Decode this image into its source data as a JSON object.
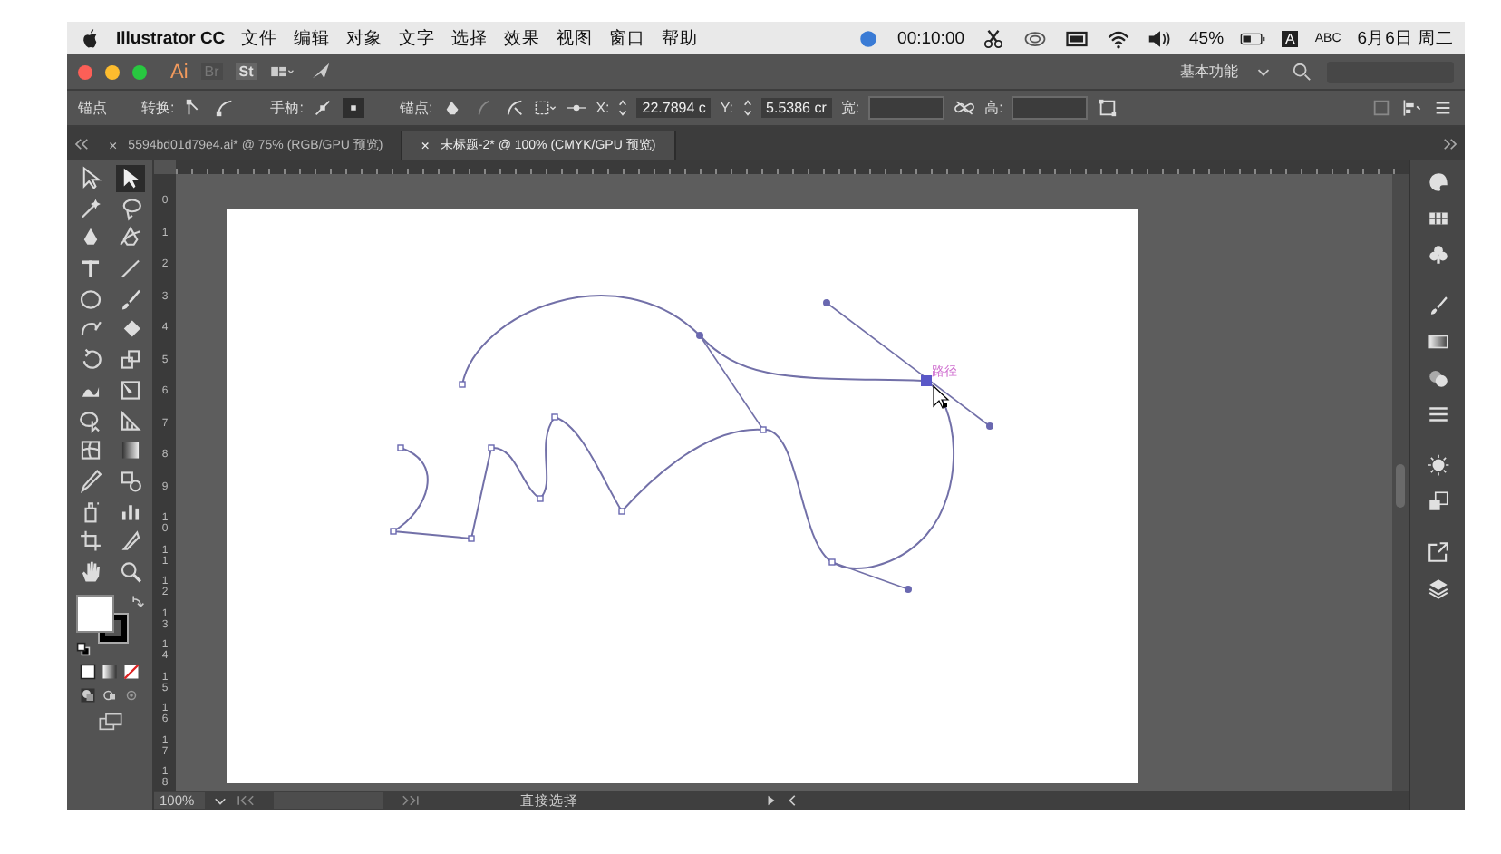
{
  "menu_bar": {
    "app": "Illustrator CC",
    "menus": [
      "文件",
      "编辑",
      "对象",
      "文字",
      "选择",
      "效果",
      "视图",
      "窗口",
      "帮助"
    ],
    "timer": "00:10:00",
    "battery": "45%",
    "input_badge": "A",
    "input_source": "ABC",
    "datetime": "6月6日 周二"
  },
  "app_bar": {
    "logo": "Ai",
    "bridge": "Br",
    "stock": "St",
    "workspace": "基本功能"
  },
  "control_bar": {
    "selection_label": "锚点",
    "convert_label": "转换:",
    "handles_label": "手柄:",
    "anchors_label": "锚点:",
    "x_label": "X:",
    "x_value": "22.7894 c",
    "y_label": "Y:",
    "y_value": "5.5386 cr",
    "width_label": "宽:",
    "height_label": "高:"
  },
  "tabs": [
    {
      "close": "×",
      "label": "5594bd01d79e4.ai* @ 75% (RGB/GPU 预览)",
      "selected": false
    },
    {
      "close": "×",
      "label": "未标题-2* @ 100% (CMYK/GPU 预览)",
      "selected": true
    }
  ],
  "tools": [
    {
      "kind": "selection",
      "selected": false
    },
    {
      "kind": "direct-selection",
      "selected": true
    },
    {
      "kind": "magic-wand",
      "selected": false
    },
    {
      "kind": "lasso",
      "selected": false
    },
    {
      "kind": "pen",
      "selected": false
    },
    {
      "kind": "curvature",
      "selected": false
    },
    {
      "kind": "type",
      "selected": false
    },
    {
      "kind": "line",
      "selected": false
    },
    {
      "kind": "ellipse",
      "selected": false
    },
    {
      "kind": "brush",
      "selected": false
    },
    {
      "kind": "shaper",
      "selected": false
    },
    {
      "kind": "eraser",
      "selected": false
    },
    {
      "kind": "rotate",
      "selected": false
    },
    {
      "kind": "scale",
      "selected": false
    },
    {
      "kind": "warp",
      "selected": false
    },
    {
      "kind": "free-transform",
      "selected": false
    },
    {
      "kind": "shape-builder",
      "selected": false
    },
    {
      "kind": "perspective",
      "selected": false
    },
    {
      "kind": "mesh",
      "selected": false
    },
    {
      "kind": "gradient",
      "selected": false
    },
    {
      "kind": "eyedropper",
      "selected": false
    },
    {
      "kind": "blend",
      "selected": false
    },
    {
      "kind": "sprayer",
      "selected": false
    },
    {
      "kind": "graph",
      "selected": false
    },
    {
      "kind": "artboard",
      "selected": false
    },
    {
      "kind": "slice",
      "selected": false
    },
    {
      "kind": "hand",
      "selected": false
    },
    {
      "kind": "zoom",
      "selected": false
    }
  ],
  "vertical_ruler": [
    "0",
    "1",
    "2",
    "3",
    "4",
    "5",
    "6",
    "7",
    "8",
    "9",
    "10",
    "11",
    "12",
    "13",
    "14",
    "15",
    "16",
    "17",
    "18"
  ],
  "canvas": {
    "smart_guide_label": "路径"
  },
  "dock": [
    {
      "kind": "color-guide"
    },
    {
      "kind": "swatches"
    },
    {
      "kind": "symbols"
    },
    {
      "kind": "brushes"
    },
    {
      "kind": "gradient"
    },
    {
      "kind": "transparency"
    },
    {
      "kind": "stroke"
    },
    {
      "kind": "appearance"
    },
    {
      "kind": "graphic-styles"
    },
    {
      "kind": "export"
    },
    {
      "kind": "layers"
    }
  ],
  "status_bar": {
    "zoom": "100%",
    "tool_name": "直接选择"
  }
}
